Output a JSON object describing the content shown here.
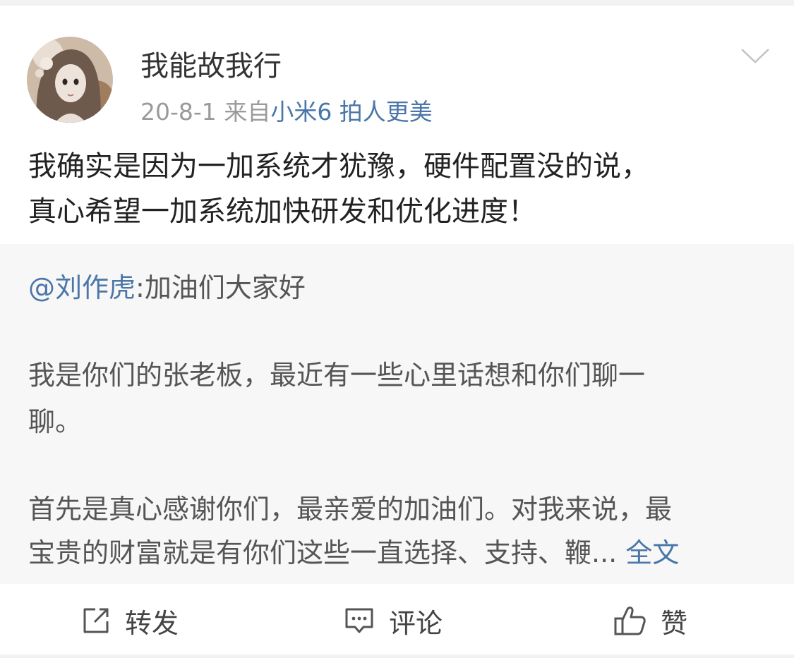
{
  "post": {
    "author": "我能故我行",
    "date": "20-8-1",
    "source_prefix": "来自",
    "source": "小米6 拍人更美",
    "text_lines": [
      "我确实是因为一加系统才犹豫，硬件配置没的说，",
      "真心希望一加系统加快研发和优化进度！"
    ]
  },
  "repost": {
    "mention": "@刘作虎",
    "first_line_rest": ":加油们大家好",
    "lines": [
      "我是你们的张老板，最近有一些心里话想和你们聊一",
      "聊。",
      "首先是真心感谢你们，最亲爱的加油们。对我来说，最",
      "宝贵的财富就是有你们这些一直选择、支持、鞭..."
    ],
    "full_text_link": "全文"
  },
  "actions": {
    "repost_label": "转发",
    "comment_label": "评论",
    "like_label": "赞"
  },
  "icons": {
    "menu": "chevron-down-icon",
    "repost": "share-icon",
    "comment": "comment-icon",
    "like": "thumbs-up-icon"
  }
}
